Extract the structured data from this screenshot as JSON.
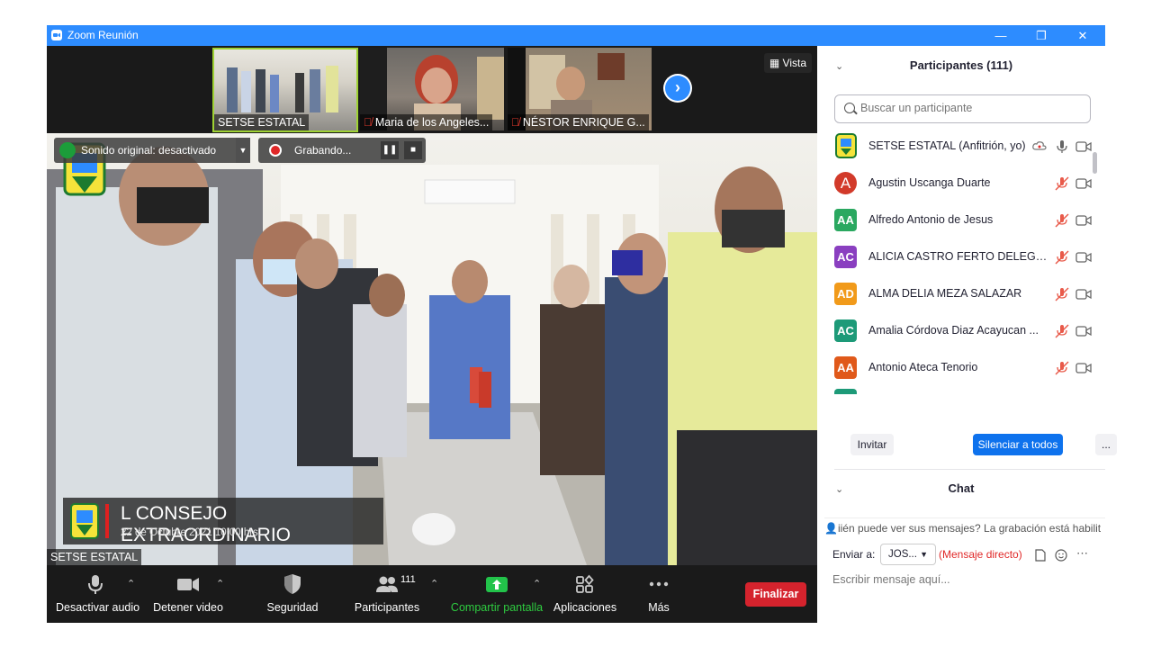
{
  "window": {
    "title": "Zoom Reunión",
    "minimize": "—",
    "restore": "❐",
    "close": "✕"
  },
  "gallery": {
    "thumbnails": [
      {
        "name": "SETSE ESTATAL"
      },
      {
        "name": "Maria de los Angeles..."
      },
      {
        "name": "NÉSTOR ENRIQUE G..."
      }
    ],
    "view_label": "Vista",
    "next_icon": "chevron-right-icon"
  },
  "main_video": {
    "original_sound": "Sonido original: desactivado",
    "recording": "Grabando...",
    "banner_title": "L CONSEJO EXTRAORDINARIO",
    "banner_subtitle": "22 de Octubre 2021 10:00 hrs.",
    "speaker_name": "SETSE ESTATAL"
  },
  "toolbar": {
    "mute": "Desactivar audio",
    "video": "Detener video",
    "security": "Seguridad",
    "participants": "Participantes",
    "participants_count": "111",
    "share": "Compartir pantalla",
    "apps": "Aplicaciones",
    "more": "Más",
    "end": "Finalizar"
  },
  "participants_panel": {
    "title": "Participantes (111)",
    "search_placeholder": "Buscar un participante",
    "list": [
      {
        "initials": "",
        "name": "SETSE ESTATAL (Anfitrión, yo)",
        "color": "#ffffff"
      },
      {
        "initials": "A",
        "name": "Agustin Uscanga Duarte",
        "color": "#d23a2a"
      },
      {
        "initials": "AA",
        "name": "Alfredo Antonio de Jesus",
        "color": "#2aa860"
      },
      {
        "initials": "AC",
        "name": "ALICIA CASTRO FERTO DELEGAC...",
        "color": "#8a3fc0"
      },
      {
        "initials": "AD",
        "name": "ALMA DELIA MEZA SALAZAR",
        "color": "#f19a1a"
      },
      {
        "initials": "AC",
        "name": "Amalia Córdova Diaz Acayucan ...",
        "color": "#1d9a78"
      },
      {
        "initials": "AA",
        "name": "Antonio Ateca Tenorio",
        "color": "#e0591a"
      }
    ],
    "invite": "Invitar",
    "mute_all": "Silenciar a todos",
    "more": "..."
  },
  "chat": {
    "title": "Chat",
    "notice": "iién puede ver sus mensajes? La grabación está habilit",
    "send_to_label": "Enviar a:",
    "recipient": "JOS...",
    "direct": "(Mensaje directo)",
    "placeholder": "Escribir mensaje aquí..."
  },
  "colors": {
    "zoom_blue": "#2d8cff",
    "end_red": "#d5232d",
    "share_green": "#0e9e3c"
  }
}
